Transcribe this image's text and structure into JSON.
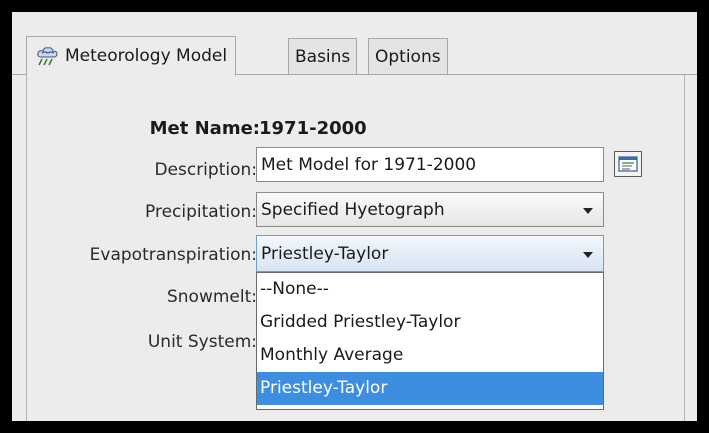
{
  "tabs": [
    {
      "label": "Meteorology Model",
      "icon": "meteorology-cloud-icon"
    },
    {
      "label": "Basins"
    },
    {
      "label": "Options"
    }
  ],
  "form": {
    "met_name_label": "Met Name:",
    "met_name_value": "1971-2000",
    "description_label": "Description:",
    "description_value": "Met Model for 1971-2000",
    "precipitation_label": "Precipitation:",
    "precipitation_value": "Specified Hyetograph",
    "evapotranspiration_label": "Evapotranspiration:",
    "evapotranspiration_value": "Priestley-Taylor",
    "snowmelt_label": "Snowmelt:",
    "unit_system_label": "Unit System:"
  },
  "evapotranspiration_options": [
    "--None--",
    "Gridded Priestley-Taylor",
    "Monthly Average",
    "Priestley-Taylor"
  ],
  "selected_option": "Priestley-Taylor",
  "colors": {
    "selection": "#3d8ee0",
    "panel": "#ececec",
    "frame": "#000000"
  }
}
